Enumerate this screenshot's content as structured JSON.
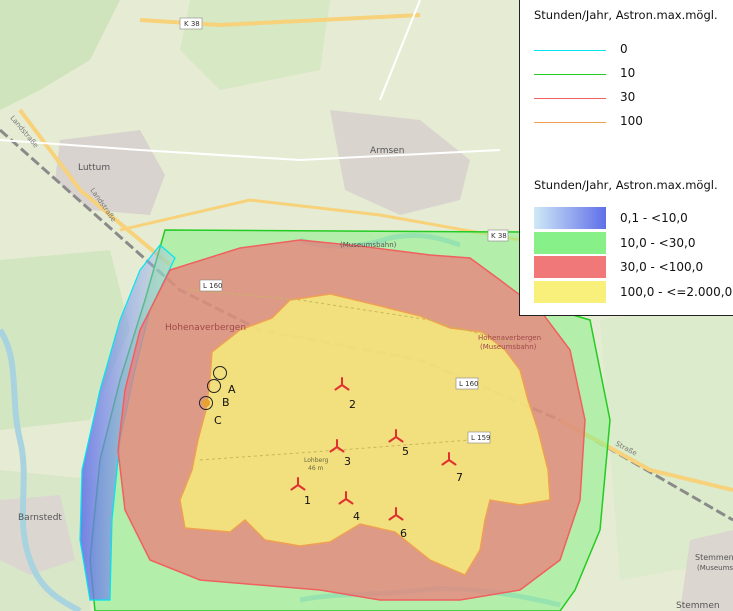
{
  "map": {
    "places": {
      "luttum": "Luttum",
      "armsen": "Armsen",
      "hohenaverbergen": "Hohenaverbergen",
      "barnstedt": "Barnstedt",
      "stemmen": "Stemmen",
      "stemmen_museum": "(Museumsb",
      "stemmen_bottom": "Stemmen",
      "armsen_museum": "(Museumsbahn)",
      "hohen_right": "Hohenaverbergen",
      "hohen_right_museum": "(Museumsbahn)"
    },
    "roads": {
      "k38_top": "K 38",
      "k38_right": "K 38",
      "l160_a": "L 160",
      "l160_b": "L 160",
      "l159": "L 159",
      "landstrasse_a": "Landstraße",
      "landstrasse_b": "Landstraße",
      "strasse_right": "Straße",
      "hill_name": "Lohberg",
      "hill_elev": "46 m"
    },
    "receptors": [
      {
        "id": "A",
        "label": "A"
      },
      {
        "id": "B",
        "label": "B"
      },
      {
        "id": "C",
        "label": "C"
      }
    ],
    "turbines": [
      {
        "id": "1",
        "label": "1"
      },
      {
        "id": "2",
        "label": "2"
      },
      {
        "id": "3",
        "label": "3"
      },
      {
        "id": "4",
        "label": "4"
      },
      {
        "id": "5",
        "label": "5"
      },
      {
        "id": "6",
        "label": "6"
      },
      {
        "id": "7",
        "label": "7"
      }
    ]
  },
  "legend": {
    "isolines_title": "Stunden/Jahr, Astron.max.mögl.",
    "isolines": [
      {
        "label": "0",
        "color": "#00e5ee"
      },
      {
        "label": "10",
        "color": "#22cc22"
      },
      {
        "label": "30",
        "color": "#f06060"
      },
      {
        "label": "100",
        "color": "#f0a050"
      }
    ],
    "areas_title": "Stunden/Jahr, Astron.max.mögl.",
    "areas": [
      {
        "label": "0,1 - <10,0",
        "color": "#5f6fe8"
      },
      {
        "label": "10,0 - <30,0",
        "color": "#88f088"
      },
      {
        "label": "30,0 - <100,0",
        "color": "#f07878"
      },
      {
        "label": "100,0 - <=2.000,0",
        "color": "#f8f07a"
      }
    ]
  },
  "colors": {
    "water": "#a9d3df",
    "road_major": "#f7d27a",
    "zone_blue": "#5f6fe8",
    "zone_green": "#88f088",
    "zone_red": "#f07878",
    "zone_yellow": "#f8f07a",
    "turbine": "#e03030"
  }
}
